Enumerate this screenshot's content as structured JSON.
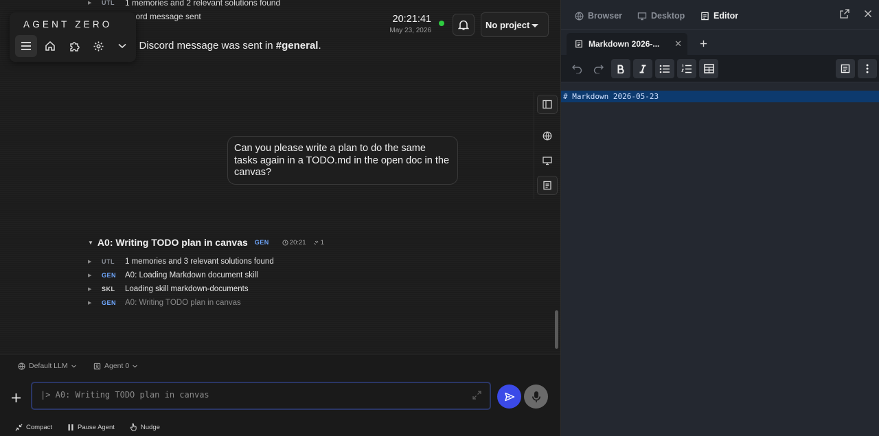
{
  "app": {
    "logo": "AGENT ZERO"
  },
  "header": {
    "time": "20:21:41",
    "date": "May 23, 2026",
    "project_label": "No project"
  },
  "chat": {
    "top_log": [
      {
        "tag": "UTL",
        "text": "1 memories and 2 relevant solutions found"
      },
      {
        "tag": "",
        "text": "Discord message sent"
      }
    ],
    "result_prefix": "e Discord message was sent in ",
    "result_channel": "#general",
    "result_suffix": ".",
    "user_message": "Can you please write a plan to do the same tasks again in a TODO.md in the open doc in the canvas?",
    "agent_title": "A0: Writing TODO plan in canvas",
    "agent_tag": "GEN",
    "agent_time": "20:21",
    "agent_count": "1",
    "steps": [
      {
        "tag": "UTL",
        "text": "1 memories and 3 relevant solutions found"
      },
      {
        "tag": "GEN",
        "text": "A0: Loading Markdown document skill"
      },
      {
        "tag": "SKL",
        "text": "Loading skill markdown-documents"
      },
      {
        "tag": "GEN",
        "text": "A0: Writing TODO plan in canvas"
      }
    ]
  },
  "bottom": {
    "llm_label": "Default LLM",
    "agent_label": "Agent 0",
    "input_value": "|> A0: Writing TODO plan in canvas",
    "actions": [
      "Compact",
      "Pause Agent",
      "Nudge"
    ]
  },
  "canvas": {
    "tabs": [
      "Browser",
      "Desktop",
      "Editor"
    ],
    "active_tab": "Editor",
    "doc_tab_title": "Markdown 2026-...",
    "editor_line": "# Markdown 2026-05-23"
  },
  "colors": {
    "accent": "#3b4ae8",
    "status_online": "#2ecc40",
    "tag_gen": "#6fa8ff",
    "selection": "#0d3a6e"
  }
}
